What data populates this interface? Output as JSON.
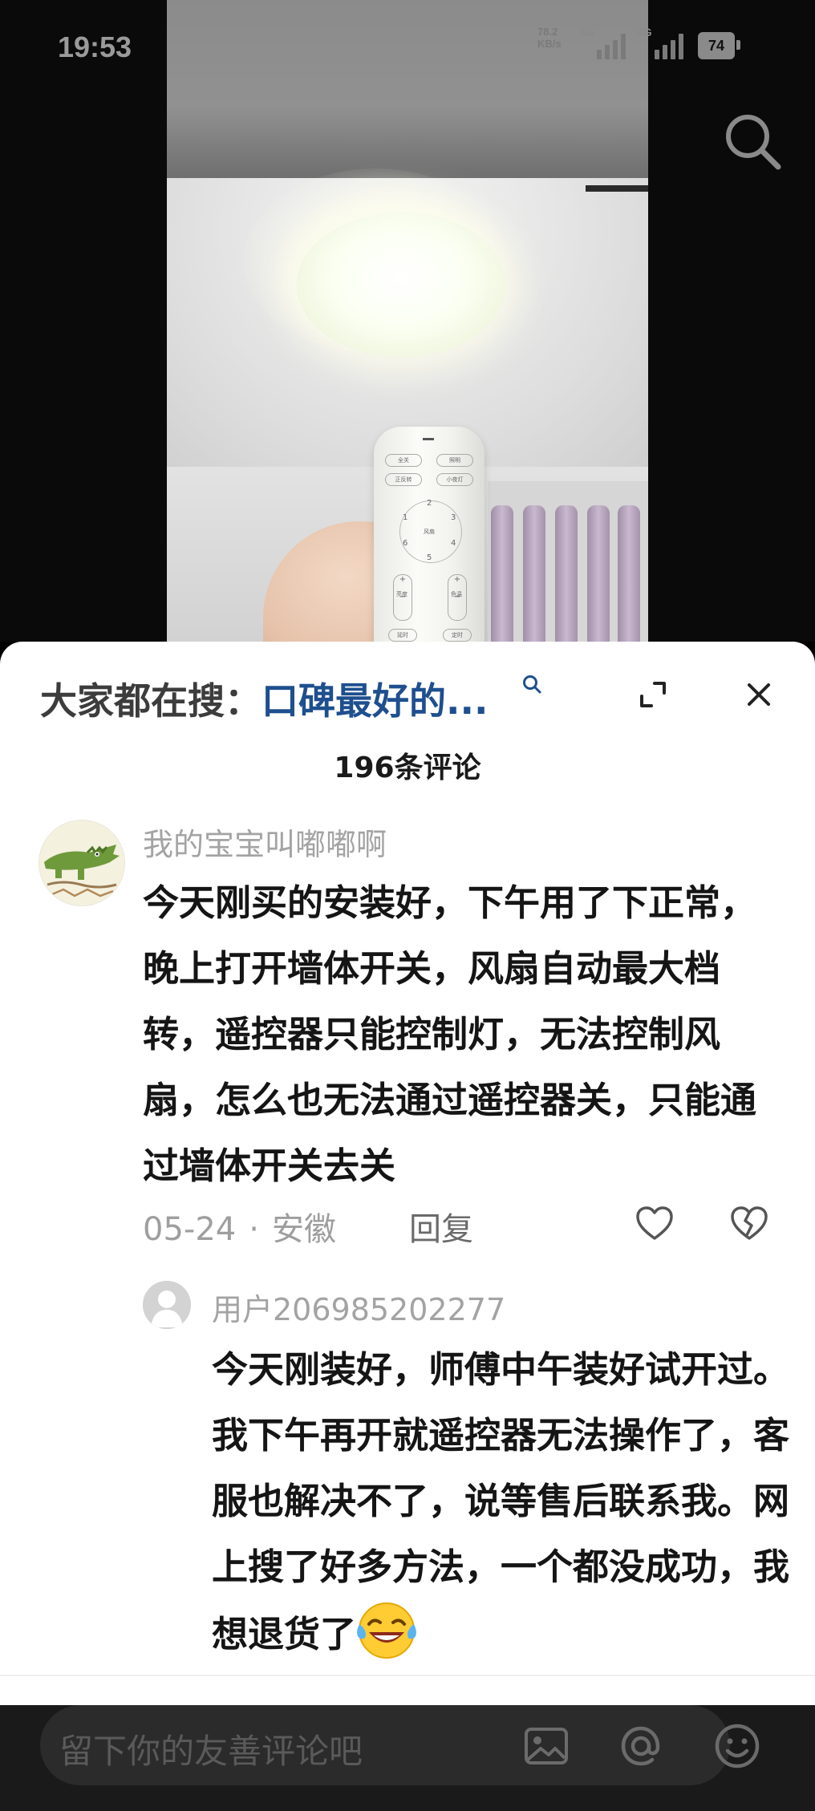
{
  "status_bar": {
    "time": "19:53",
    "net_speed_value": "78.2",
    "net_speed_unit": "KB/s",
    "sim1_label": "4G",
    "sim2_label": "4G",
    "battery": "74"
  },
  "video": {
    "remote_buttons": [
      "全关",
      "照明",
      "正反转",
      "小夜灯",
      "风扇",
      "亮度",
      "色温",
      "延时",
      "定时"
    ],
    "remote_numbers": [
      "1",
      "2",
      "3",
      "4",
      "5",
      "6"
    ],
    "search_icon": "search-icon"
  },
  "comments_sheet": {
    "hot_search_prefix": "大家都在搜：",
    "hot_search_query": "口碑最好的...",
    "comment_count_title": "196条评论",
    "comments": [
      {
        "username": "我的宝宝叫嘟嘟啊",
        "text": "今天刚买的安装好，下午用了下正常，晚上打开墙体开关，风扇自动最大档转，遥控器只能控制灯，无法控制风扇，怎么也无法通过遥控器关，只能通过墙体开关去关",
        "date": "05-24",
        "location": "安徽",
        "reply_label": "回复",
        "replies": [
          {
            "username": "用户206985202277",
            "text": "今天刚装好，师傅中午装好试开过。我下午再开就遥控器无法操作了，客服也解决不了，说等售后联系我。网上搜了好多方法，一个都没成功，我想退货了",
            "emoji": "laughing-crying-emoji"
          }
        ]
      }
    ]
  },
  "input_bar": {
    "placeholder": "留下你的友善评论吧",
    "icons": [
      "image-icon",
      "at-icon",
      "emoji-icon"
    ]
  },
  "colors": {
    "hot_search_query": "#1e4f8f",
    "username": "#a3a3a3",
    "comment_text": "#151515",
    "sheet_background": "#ffffff",
    "input_bar_background": "#1a1a1a"
  }
}
